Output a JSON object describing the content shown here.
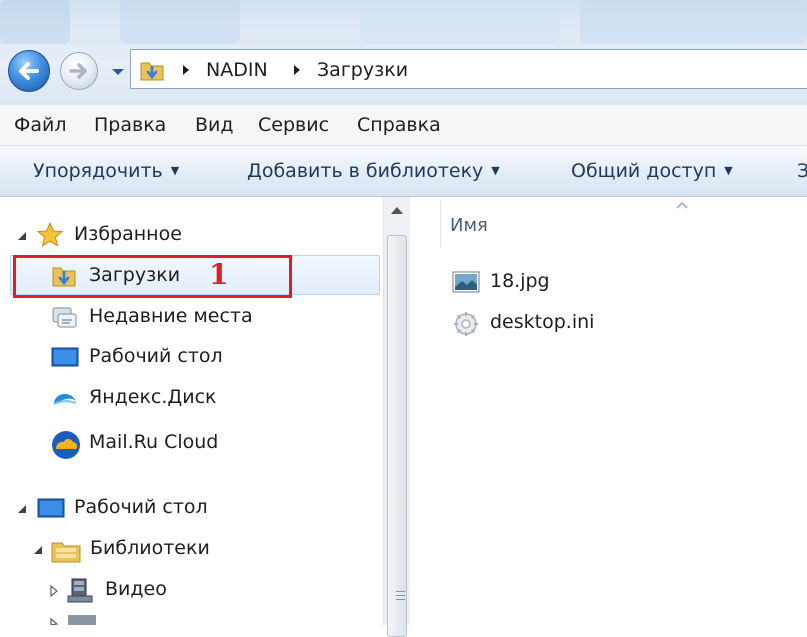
{
  "window": {
    "address": {
      "crumbs": [
        {
          "label": "NADIN"
        },
        {
          "label": "Загрузки"
        }
      ]
    }
  },
  "menubar": {
    "items": [
      {
        "label": "Файл"
      },
      {
        "label": "Правка"
      },
      {
        "label": "Вид"
      },
      {
        "label": "Сервис"
      },
      {
        "label": "Справка"
      }
    ]
  },
  "toolbar": {
    "items": [
      {
        "label": "Упорядочить"
      },
      {
        "label": "Добавить в библиотеку"
      },
      {
        "label": "Общий доступ"
      }
    ],
    "overflow_label": "З"
  },
  "navpane": {
    "favorites": {
      "label": "Избранное",
      "items": [
        {
          "label": "Загрузки",
          "selected": true,
          "icon": "downloads-folder-icon"
        },
        {
          "label": "Недавние места",
          "icon": "recent-places-icon"
        },
        {
          "label": "Рабочий стол",
          "icon": "desktop-icon"
        },
        {
          "label": "Яндекс.Диск",
          "icon": "yandex-disk-icon"
        },
        {
          "label": "Mail.Ru Cloud",
          "icon": "mailru-cloud-icon"
        }
      ]
    },
    "desktop": {
      "label": "Рабочий стол",
      "libraries": {
        "label": "Библиотеки",
        "items": [
          {
            "label": "Видео",
            "icon": "video-library-icon"
          }
        ]
      }
    }
  },
  "content": {
    "column_header": "Имя",
    "files": [
      {
        "name": "18.jpg",
        "icon": "image-file-icon"
      },
      {
        "name": "desktop.ini",
        "icon": "settings-file-icon"
      }
    ]
  },
  "annotation": {
    "label": "1",
    "color": "#e02020"
  },
  "colors": {
    "accent": "#3f8fe0",
    "selection_fill": "#e2eefc",
    "selection_border": "#b9d4f3",
    "toolbar_text": "#1e395b"
  }
}
